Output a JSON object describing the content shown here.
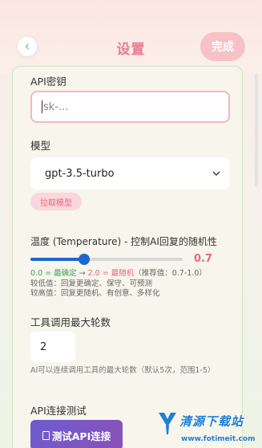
{
  "header": {
    "title": "设置",
    "done_label": "完成"
  },
  "api_key": {
    "label": "API密钥",
    "placeholder": "sk-..."
  },
  "model": {
    "label": "模型",
    "selected": "gpt-3.5-turbo",
    "pull_label": "拉取模型"
  },
  "temperature": {
    "label": "温度 (Temperature) - 控制AI回复的随机性",
    "value_text": "0.7",
    "value": 0.7,
    "min": 0,
    "max": 2,
    "hint_line1_det": "0.0 = 最确定",
    "hint_line1_arrow": " → ",
    "hint_line1_rnd": "2.0 = 最随机",
    "hint_line1_rec": "（推荐值：0.7-1.0）",
    "hint_line2": "较低值：回复更确定、保守、可预测",
    "hint_line3": "较高值：回复更随机、有创意、多样化"
  },
  "tools": {
    "label": "工具调用最大轮数",
    "value": "2",
    "hint": "AI可以连续调用工具的最大轮数（默认5次，范围1-5）"
  },
  "api_test": {
    "label": "API连接测试",
    "button_label": "测试API连接"
  },
  "watermark": {
    "text": "清源下载站",
    "url": "www.fotimeit.com"
  },
  "colors": {
    "accent_pink": "#e87e8e",
    "slider_blue": "#1e66d0",
    "button_purple": "#6d5bd0"
  }
}
